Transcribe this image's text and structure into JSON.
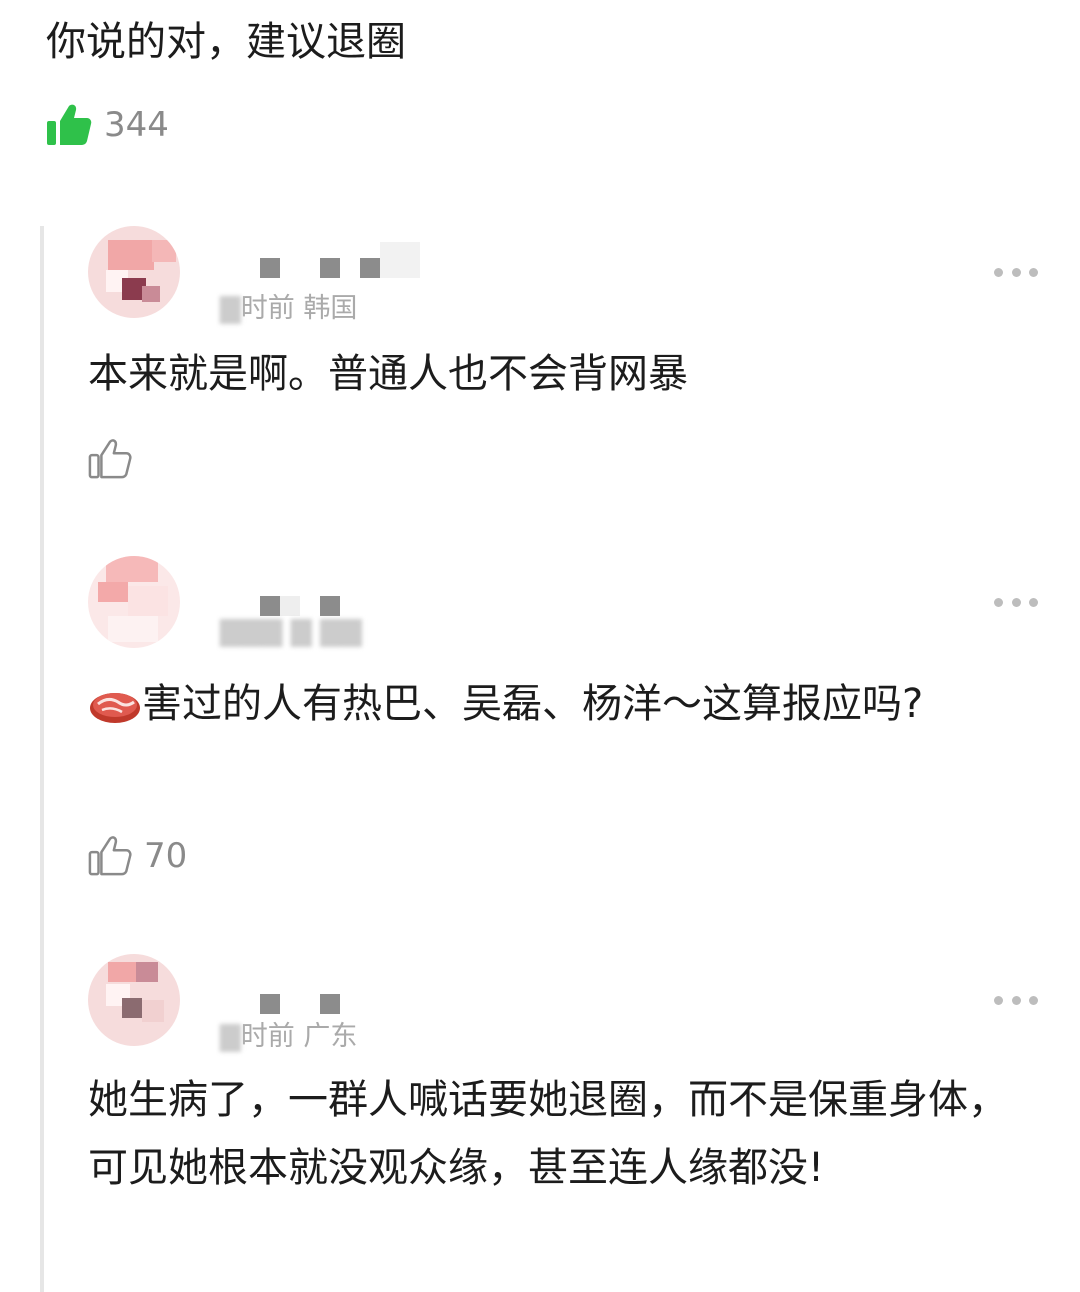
{
  "main_comment": {
    "text": "你说的对，建议退圈",
    "like_count": "344"
  },
  "replies": [
    {
      "meta_visible": "时前 韩国",
      "text": "本来就是啊。普通人也不会背网暴",
      "like_count": ""
    },
    {
      "meta_visible": "",
      "text_emoji": "meat-emoji",
      "text": "害过的人有热巴、吴磊、杨洋～这算报应吗?",
      "like_count": "70"
    },
    {
      "meta_visible": "时前 广东",
      "text": "她生病了，一群人喊话要她退圈，而不是保重身体，可见她根本就没观众缘，甚至连人缘都没!",
      "like_count": ""
    }
  ],
  "colors": {
    "like_active": "#2fc14a",
    "text": "#1c1c1c",
    "secondary": "#8a8a8a",
    "thread_line": "#e6e6e6"
  }
}
